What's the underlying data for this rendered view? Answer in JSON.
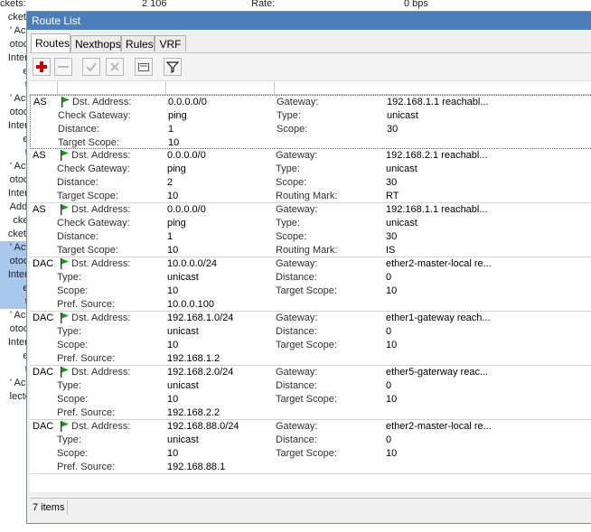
{
  "background_window": {
    "top_packets": "2 106",
    "top_rate_label": "Rate:",
    "top_rate_value": "0 bps",
    "top_left_label": "ckets:",
    "left_rows": [
      "cket R",
      "' Actio",
      "otocol",
      "Interfa",
      "es:",
      "te:",
      "' Actio",
      "otocol",
      "Interfa",
      "es:",
      "te:",
      "' Actio",
      "otocol",
      "Interfa",
      "Addre",
      "ckets",
      "cket R",
      "' Actio",
      "otocol",
      "Interfa",
      "es:",
      "te:",
      "' Actio",
      "otocol",
      "Interfa",
      "es:",
      "te:",
      "' Actio",
      "lected"
    ]
  },
  "window": {
    "title": "Route List"
  },
  "tabs": [
    {
      "label": "Routes",
      "active": true
    },
    {
      "label": "Nexthops",
      "active": false
    },
    {
      "label": "Rules",
      "active": false
    },
    {
      "label": "VRF",
      "active": false
    }
  ],
  "toolbar": {
    "icons": [
      "add-icon",
      "remove-icon",
      "enable-icon",
      "disable-icon",
      "comment-icon",
      "filter-icon"
    ],
    "colors": {
      "add": "#cc0000",
      "disabled": "#b8b8b8",
      "filter": "#202020"
    }
  },
  "routes": [
    {
      "flags": "AS",
      "fields": [
        [
          "Dst. Address:",
          "0.0.0.0/0",
          "Gateway:",
          "192.168.1.1 reachabl..."
        ],
        [
          "Check Gateway:",
          "ping",
          "Type:",
          "unicast"
        ],
        [
          "Distance:",
          "1",
          "Scope:",
          "30"
        ],
        [
          "Target Scope:",
          "10",
          "",
          ""
        ]
      ]
    },
    {
      "flags": "AS",
      "fields": [
        [
          "Dst. Address:",
          "0.0.0.0/0",
          "Gateway:",
          "192.168.2.1 reachabl..."
        ],
        [
          "Check Gateway:",
          "ping",
          "Type:",
          "unicast"
        ],
        [
          "Distance:",
          "2",
          "Scope:",
          "30"
        ],
        [
          "Target Scope:",
          "10",
          "Routing Mark:",
          "RT"
        ]
      ]
    },
    {
      "flags": "AS",
      "fields": [
        [
          "Dst. Address:",
          "0.0.0.0/0",
          "Gateway:",
          "192.168.1.1 reachabl..."
        ],
        [
          "Check Gateway:",
          "ping",
          "Type:",
          "unicast"
        ],
        [
          "Distance:",
          "1",
          "Scope:",
          "30"
        ],
        [
          "Target Scope:",
          "10",
          "Routing Mark:",
          "IS"
        ]
      ]
    },
    {
      "flags": "DAC",
      "fields": [
        [
          "Dst. Address:",
          "10.0.0.0/24",
          "Gateway:",
          "ether2-master-local re..."
        ],
        [
          "Type:",
          "unicast",
          "Distance:",
          "0"
        ],
        [
          "Scope:",
          "10",
          "Target Scope:",
          "10"
        ],
        [
          "Pref. Source:",
          "10.0.0.100",
          "",
          ""
        ]
      ]
    },
    {
      "flags": "DAC",
      "fields": [
        [
          "Dst. Address:",
          "192.168.1.0/24",
          "Gateway:",
          "ether1-gateway reach..."
        ],
        [
          "Type:",
          "unicast",
          "Distance:",
          "0"
        ],
        [
          "Scope:",
          "10",
          "Target Scope:",
          "10"
        ],
        [
          "Pref. Source:",
          "192.168.1.2",
          "",
          ""
        ]
      ]
    },
    {
      "flags": "DAC",
      "fields": [
        [
          "Dst. Address:",
          "192.168.2.0/24",
          "Gateway:",
          "ether5-gaterway reac..."
        ],
        [
          "Type:",
          "unicast",
          "Distance:",
          "0"
        ],
        [
          "Scope:",
          "10",
          "Target Scope:",
          "10"
        ],
        [
          "Pref. Source:",
          "192.168.2.2",
          "",
          ""
        ]
      ]
    },
    {
      "flags": "DAC",
      "fields": [
        [
          "Dst. Address:",
          "192.168.88.0/24",
          "Gateway:",
          "ether2-master-local re..."
        ],
        [
          "Type:",
          "unicast",
          "Distance:",
          "0"
        ],
        [
          "Scope:",
          "10",
          "Target Scope:",
          "10"
        ],
        [
          "Pref. Source:",
          "192.168.88.1",
          "",
          ""
        ]
      ]
    }
  ],
  "status": {
    "count": "7 items"
  },
  "colors": {
    "titlebar": "#4e7dbb",
    "flag_green": "#1a9a1a",
    "selection": "#a8c8ec"
  }
}
